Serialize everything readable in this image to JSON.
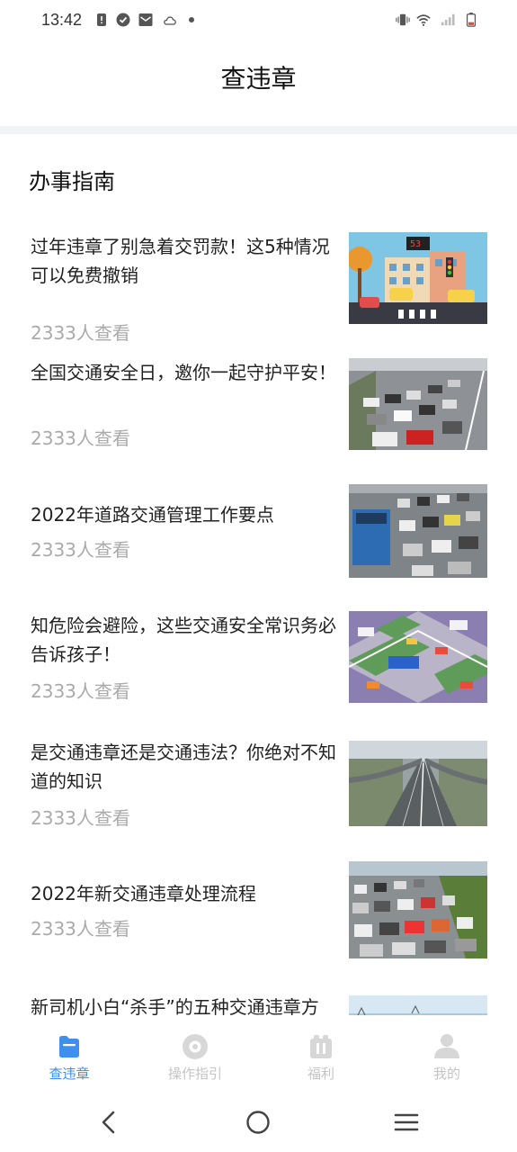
{
  "status_bar": {
    "time": "13:42",
    "icons": [
      "alert-icon",
      "check-circle-icon",
      "mail-icon",
      "cloud-icon",
      "dot-icon",
      "vibrate-icon",
      "wifi-icon",
      "signal-icon",
      "battery-icon"
    ]
  },
  "header": {
    "title": "查违章"
  },
  "section": {
    "title": "办事指南"
  },
  "articles": [
    {
      "title": "过年违章了别急着交罚款！这5种情况可以免费撤销",
      "views": "2333人查看",
      "image": "city-street-illustration"
    },
    {
      "title": "全国交通安全日，邀你一起守护平安！",
      "views": "2333人查看",
      "image": "traffic-jam-photo"
    },
    {
      "title": "2022年道路交通管理工作要点",
      "views": "2333人查看",
      "image": "bus-traffic-photo"
    },
    {
      "title": "知危险会避险，这些交通安全常识务必告诉孩子！",
      "views": "2333人查看",
      "image": "isometric-intersection-illustration"
    },
    {
      "title": "是交通违章还是交通违法？你绝对不知道的知识",
      "views": "2333人查看",
      "image": "highway-aerial-photo"
    },
    {
      "title": "2022年新交通违章处理流程",
      "views": "2333人查看",
      "image": "congested-road-photo"
    },
    {
      "title": "新司机小白“杀手”的五种交通违章方",
      "views": "",
      "image": "sky-photo"
    }
  ],
  "tabs": [
    {
      "label": "查违章",
      "icon": "folder-icon",
      "active": true
    },
    {
      "label": "操作指引",
      "icon": "disc-icon",
      "active": false
    },
    {
      "label": "福利",
      "icon": "gift-icon",
      "active": false
    },
    {
      "label": "我的",
      "icon": "person-icon",
      "active": false
    }
  ],
  "colors": {
    "accent": "#3f8ff0",
    "inactive": "#c4c4c4",
    "muted_text": "#aaaaaa",
    "band": "#f2f3f5"
  }
}
